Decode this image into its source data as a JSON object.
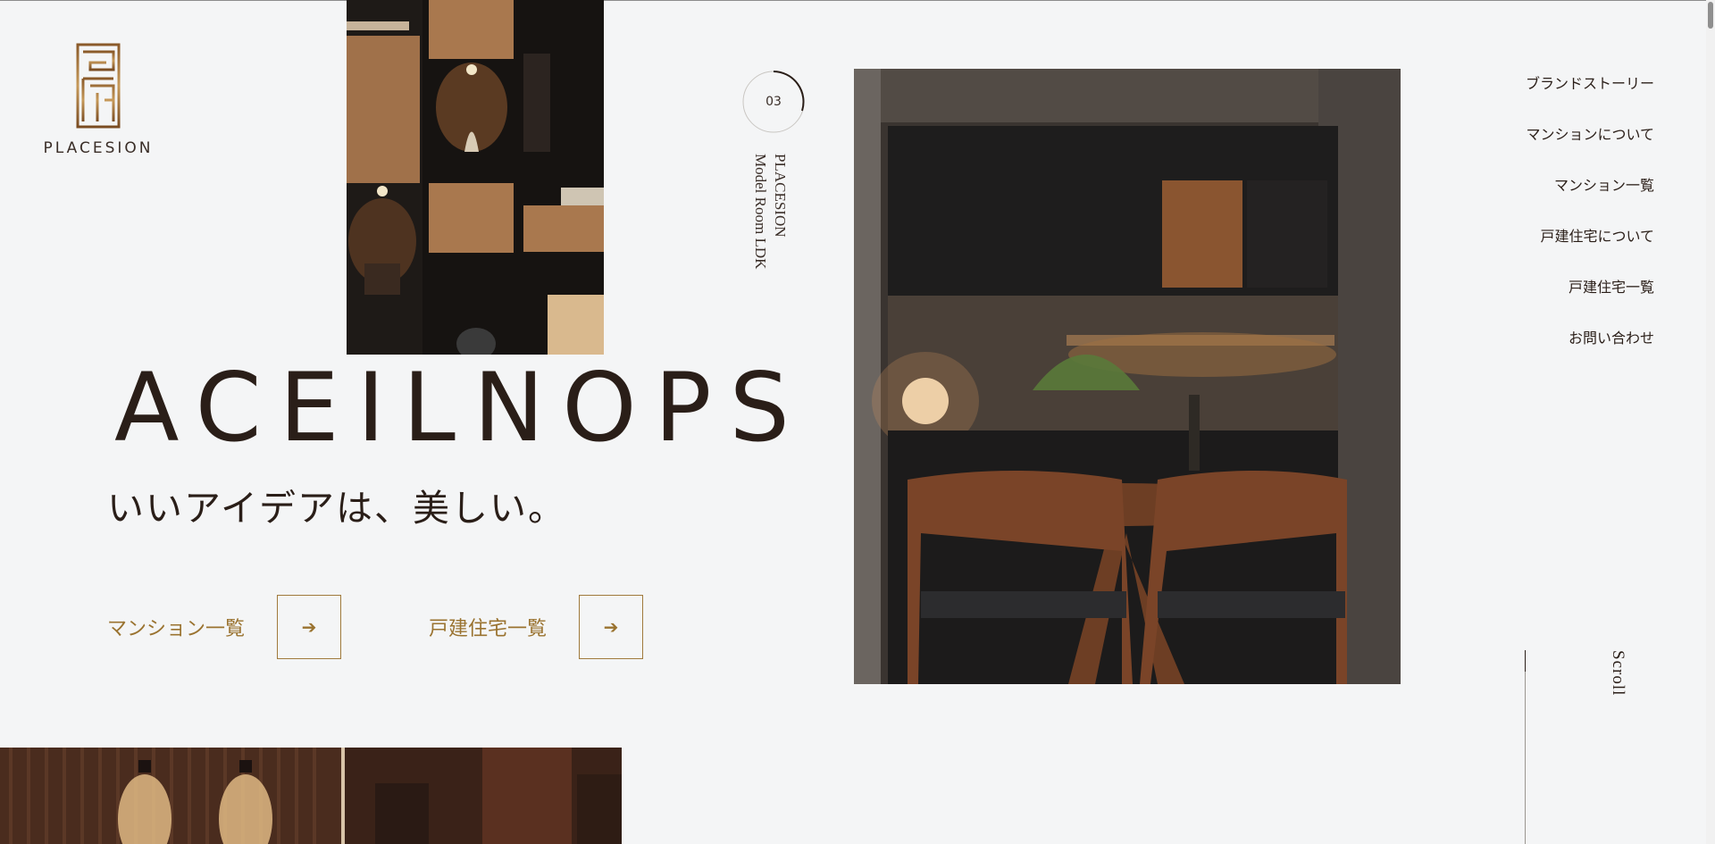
{
  "brand": {
    "logo_text": "PLACESION"
  },
  "slide": {
    "number": "03",
    "caption_line1": "PLACESION",
    "caption_line2": "Model Room LDK"
  },
  "nav": {
    "items": [
      {
        "label": "ブランドストーリー"
      },
      {
        "label": "マンションについて"
      },
      {
        "label": "マンション一覧"
      },
      {
        "label": "戸建住宅について"
      },
      {
        "label": "戸建住宅一覧"
      },
      {
        "label": "お問い合わせ"
      }
    ]
  },
  "hero": {
    "title": "ACEILNOPS",
    "subtitle": "いいアイデアは、美しい。"
  },
  "cta": {
    "mansion_label": "マンション一覧",
    "house_label": "戸建住宅一覧",
    "arrow": "➔"
  },
  "scroll": {
    "label": "Scroll"
  },
  "colors": {
    "accent_gold": "#9a7330",
    "text_dark": "#2a1e18",
    "background": "#f4f5f6"
  }
}
